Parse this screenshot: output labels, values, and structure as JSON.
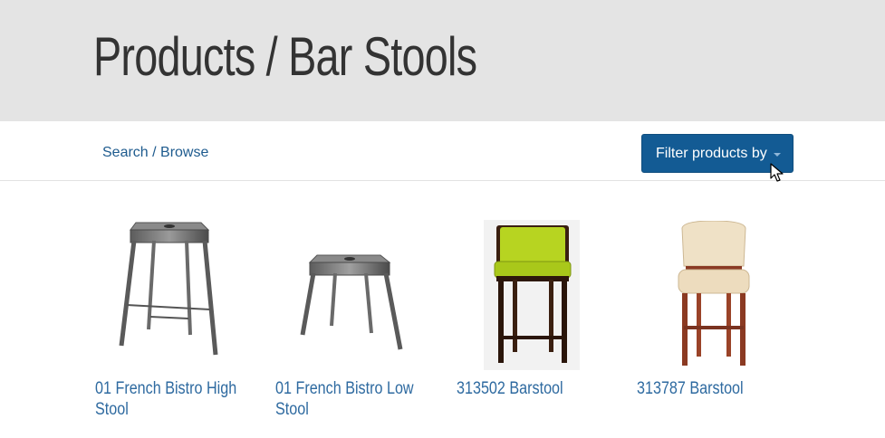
{
  "header": {
    "title": "Products / Bar Stools"
  },
  "toolbar": {
    "search_link": "Search / Browse",
    "filter_button": "Filter products by"
  },
  "products": [
    {
      "name": "01 French Bistro High Stool",
      "image": "metal-high-stool-icon"
    },
    {
      "name": "01 French Bistro Low Stool",
      "image": "metal-low-stool-icon"
    },
    {
      "name": "313502 Barstool",
      "image": "lime-upholstered-barstool-icon"
    },
    {
      "name": "313787 Barstool",
      "image": "cream-upholstered-barstool-icon"
    }
  ],
  "colors": {
    "header_bg": "#e4e4e4",
    "button_bg": "#135b94",
    "link": "#1e5b8e",
    "product_link": "#2e6aa0"
  }
}
